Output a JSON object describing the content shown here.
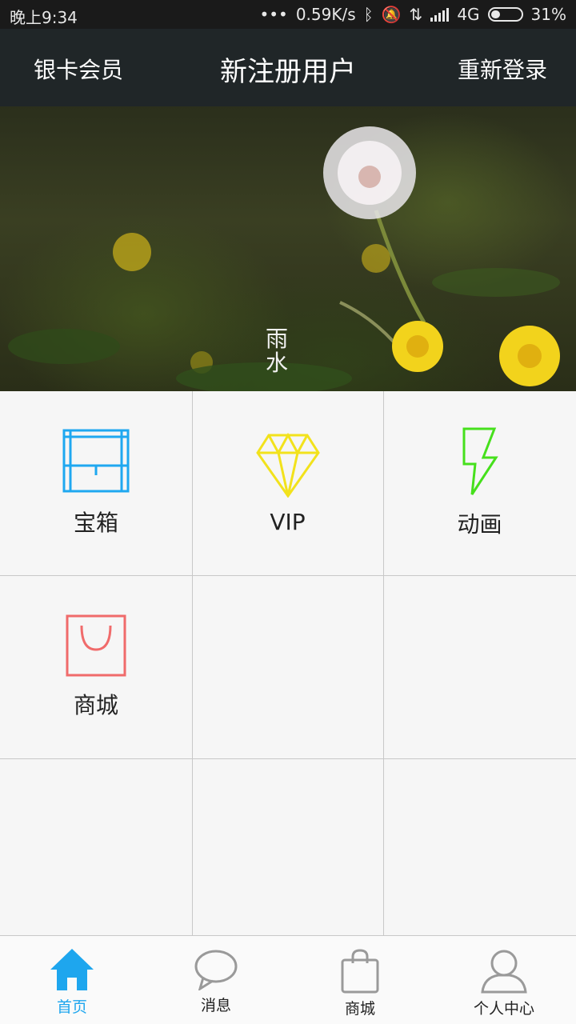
{
  "status_bar": {
    "time": "晚上9:34",
    "speed": "0.59K/s",
    "network": "4G",
    "battery": "31%",
    "battery_level": 0.31
  },
  "header": {
    "left": "银卡会员",
    "title": "新注册用户",
    "right": "重新登录"
  },
  "banner": {
    "caption": "雨\n水"
  },
  "grid": {
    "items": [
      {
        "label": "宝箱",
        "icon": "treasure-chest-icon",
        "color": "#1fa8f0"
      },
      {
        "label": "VIP",
        "icon": "diamond-icon",
        "color": "#f2e21c"
      },
      {
        "label": "动画",
        "icon": "lightning-icon",
        "color": "#46e01c"
      },
      {
        "label": "商城",
        "icon": "shopping-bag-icon",
        "color": "#f06b6b"
      }
    ]
  },
  "tabbar": {
    "tabs": [
      {
        "label": "首页",
        "icon": "home-icon",
        "active": true
      },
      {
        "label": "消息",
        "icon": "chat-bubble-icon",
        "active": false
      },
      {
        "label": "商城",
        "icon": "shopping-bag-icon",
        "active": false
      },
      {
        "label": "个人中心",
        "icon": "user-icon",
        "active": false
      }
    ],
    "active_color": "#1ea6ee"
  }
}
